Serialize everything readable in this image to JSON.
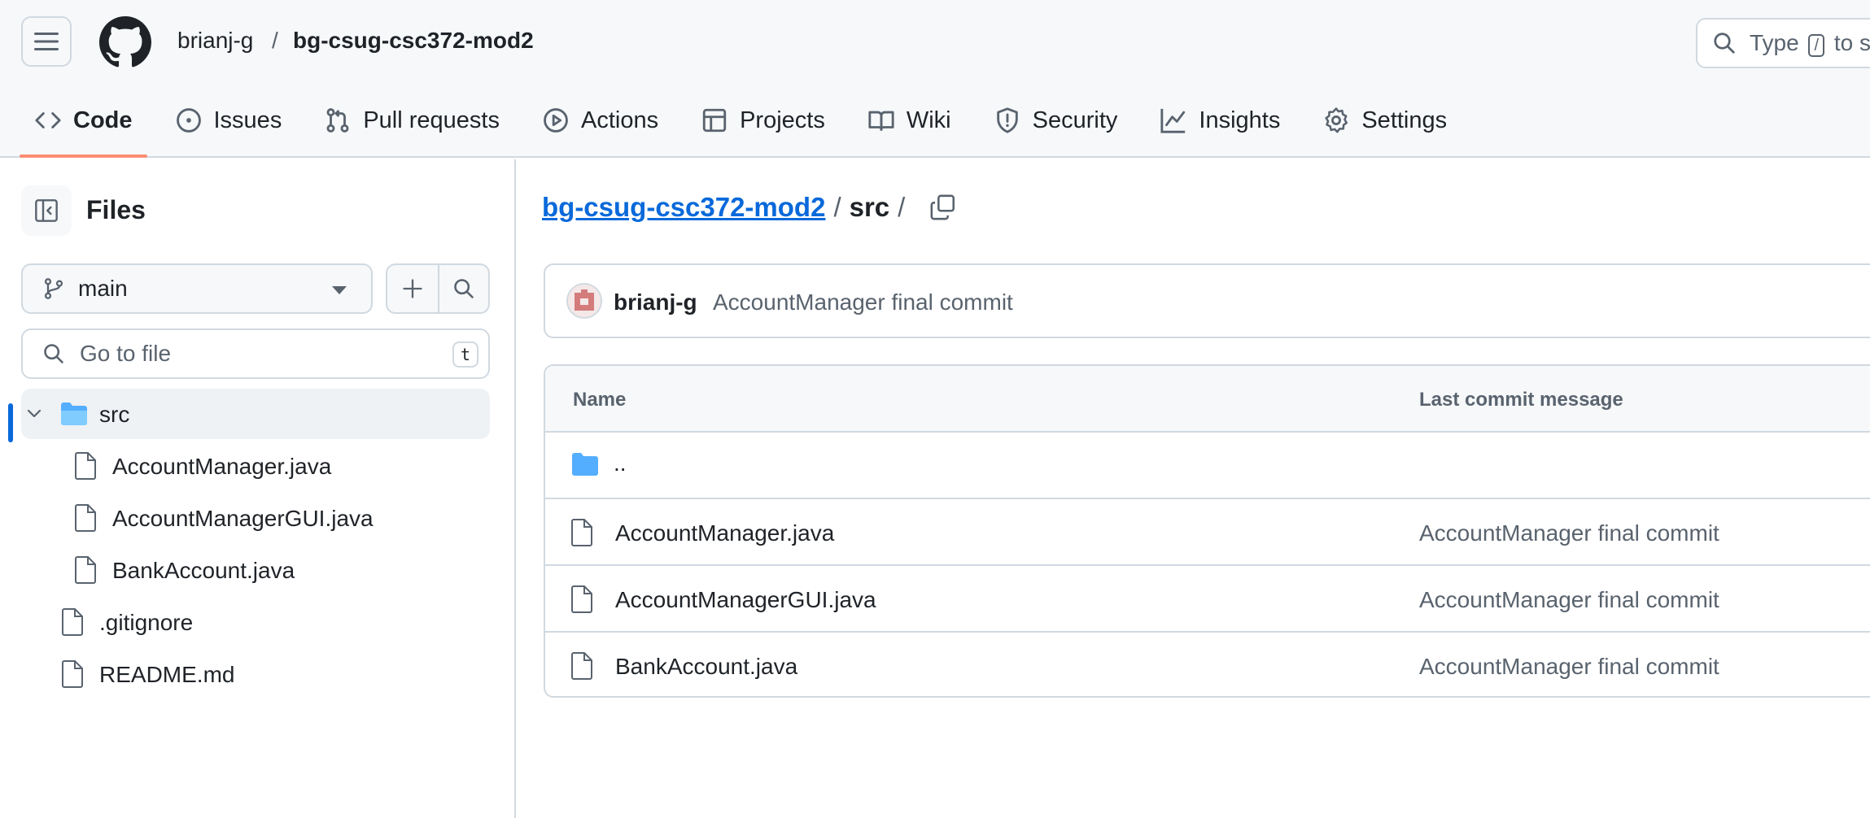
{
  "header": {
    "owner": "brianj-g",
    "separator": "/",
    "repo": "bg-csug-csc372-mod2",
    "search_prefix": "Type",
    "search_key": "/",
    "search_suffix": "to s"
  },
  "tabs": [
    {
      "label": "Code",
      "icon": "code-icon",
      "active": true
    },
    {
      "label": "Issues",
      "icon": "issue-opened-icon"
    },
    {
      "label": "Pull requests",
      "icon": "git-pull-request-icon"
    },
    {
      "label": "Actions",
      "icon": "play-icon"
    },
    {
      "label": "Projects",
      "icon": "table-icon"
    },
    {
      "label": "Wiki",
      "icon": "book-icon"
    },
    {
      "label": "Security",
      "icon": "shield-icon"
    },
    {
      "label": "Insights",
      "icon": "graph-icon"
    },
    {
      "label": "Settings",
      "icon": "gear-icon"
    }
  ],
  "sidebar": {
    "title": "Files",
    "branch": "main",
    "goto_placeholder": "Go to file",
    "goto_shortcut": "t",
    "tree": [
      {
        "label": "src",
        "type": "folder",
        "expanded": true,
        "selected": true
      },
      {
        "label": "AccountManager.java",
        "type": "file",
        "nested": true
      },
      {
        "label": "AccountManagerGUI.java",
        "type": "file",
        "nested": true
      },
      {
        "label": "BankAccount.java",
        "type": "file",
        "nested": true
      },
      {
        "label": ".gitignore",
        "type": "file"
      },
      {
        "label": "README.md",
        "type": "file"
      }
    ]
  },
  "main": {
    "path_root": "bg-csug-csc372-mod2",
    "path_sep": "/",
    "path_current": "src",
    "path_trailing": "/",
    "commit": {
      "author": "brianj-g",
      "message": "AccountManager final commit"
    },
    "table": {
      "col_name": "Name",
      "col_message": "Last commit message",
      "rows": [
        {
          "name": "..",
          "type": "parent",
          "message": ""
        },
        {
          "name": "AccountManager.java",
          "type": "file",
          "message": "AccountManager final commit"
        },
        {
          "name": "AccountManagerGUI.java",
          "type": "file",
          "message": "AccountManager final commit"
        },
        {
          "name": "BankAccount.java",
          "type": "file",
          "message": "AccountManager final commit"
        }
      ]
    }
  },
  "colors": {
    "accent_link": "#0969da",
    "tab_underline": "#fd8c73",
    "folder": "#54aeff",
    "border": "#d1d9e0",
    "muted_text": "#59636e"
  }
}
